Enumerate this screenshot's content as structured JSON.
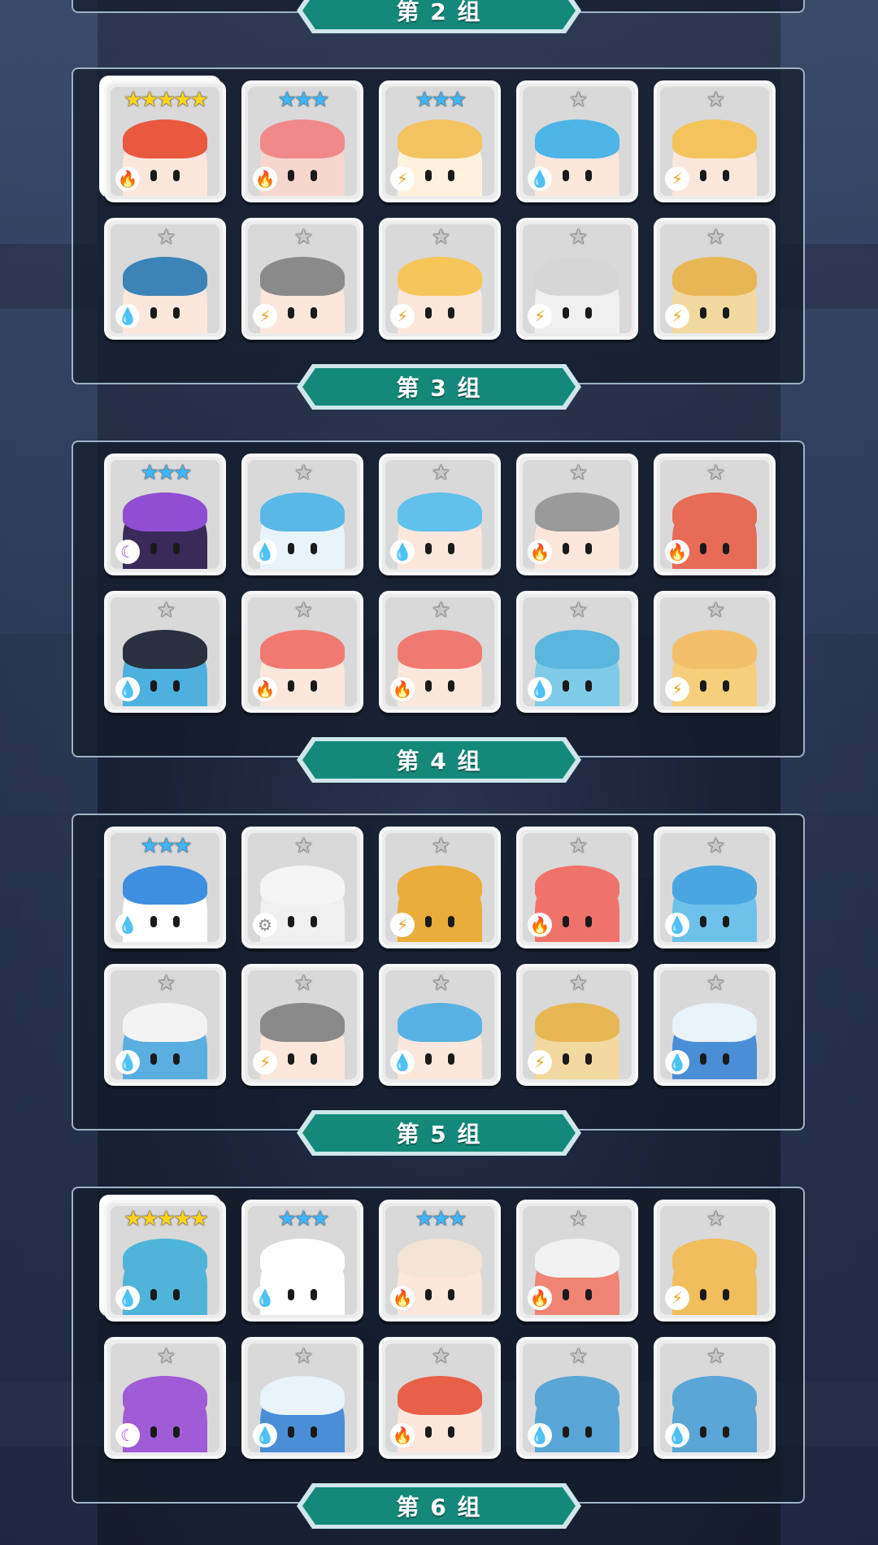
{
  "colors": {
    "banner": "#14897a",
    "banner_edge": "#cfe6ea",
    "fire": "#e0462a",
    "water": "#2f8fe0",
    "lightning": "#e8a322",
    "dark": "#a54ad8",
    "light": "#8c8c8c",
    "star_gold": "#ffd21e",
    "star_blue": "#3fb6ff",
    "star_white": "#c8c8c8"
  },
  "element_icons": {
    "fire": "🔥",
    "water": "💧",
    "lightning": "⚡",
    "dark": "☾",
    "light": "⚙"
  },
  "labels": [
    "第 2 组",
    "第 3 组",
    "第 4 组",
    "第 5 组",
    "第 6 组"
  ],
  "groups": [
    {
      "cards": [
        {
          "stars": "★★★★★",
          "star_color": "gold",
          "element": "fire",
          "highlight": true,
          "hair": "#e8593f",
          "skin": "#fbe7dc"
        },
        {
          "stars": "★★★",
          "star_color": "blue",
          "element": "fire",
          "hair": "#f08a8a",
          "skin": "#f6d7cf"
        },
        {
          "stars": "★★★",
          "star_color": "blue",
          "element": "lightning",
          "hair": "#f2c462",
          "skin": "#fff1dc"
        },
        {
          "stars": "★",
          "star_color": "white",
          "element": "water",
          "hair": "#4cb5e6",
          "skin": "#fbe7dc"
        },
        {
          "stars": "★",
          "star_color": "white",
          "element": "lightning",
          "hair": "#f3c45c",
          "skin": "#fbe7dc"
        },
        {
          "stars": "★",
          "star_color": "white",
          "element": "water",
          "hair": "#3c84b7",
          "skin": "#fbe7dc"
        },
        {
          "stars": "★",
          "star_color": "white",
          "element": "lightning",
          "hair": "#8a8a8a",
          "skin": "#fbe7dc"
        },
        {
          "stars": "★",
          "star_color": "white",
          "element": "lightning",
          "hair": "#f5c65a",
          "skin": "#fbe7dc"
        },
        {
          "stars": "★",
          "star_color": "white",
          "element": "lightning",
          "hair": "#d6d6d6",
          "skin": "#f0f0f0"
        },
        {
          "stars": "★",
          "star_color": "white",
          "element": "lightning",
          "hair": "#e8b755",
          "skin": "#f1d9a0"
        }
      ]
    },
    {
      "cards": [
        {
          "stars": "★★★",
          "star_color": "blue",
          "element": "dark",
          "hair": "#8f4ed3",
          "skin": "#3a2a5a"
        },
        {
          "stars": "★",
          "star_color": "white",
          "element": "water",
          "hair": "#5ab8e9",
          "skin": "#e8f4fa"
        },
        {
          "stars": "★",
          "star_color": "white",
          "element": "water",
          "hair": "#62c0ec",
          "skin": "#fbe7dc"
        },
        {
          "stars": "★",
          "star_color": "white",
          "element": "fire",
          "hair": "#9a9a9a",
          "skin": "#fbe7dc"
        },
        {
          "stars": "★",
          "star_color": "white",
          "element": "fire",
          "hair": "#e86b58",
          "skin": "#e86b58"
        },
        {
          "stars": "★",
          "star_color": "white",
          "element": "water",
          "hair": "#2a3040",
          "skin": "#4db0de"
        },
        {
          "stars": "★",
          "star_color": "white",
          "element": "fire",
          "hair": "#f07a72",
          "skin": "#fbe7dc"
        },
        {
          "stars": "★",
          "star_color": "white",
          "element": "fire",
          "hair": "#f07a72",
          "skin": "#fbe7dc"
        },
        {
          "stars": "★",
          "star_color": "white",
          "element": "water",
          "hair": "#5bb6dd",
          "skin": "#7fcbe8"
        },
        {
          "stars": "★",
          "star_color": "white",
          "element": "lightning",
          "hair": "#f2c06a",
          "skin": "#f6cf7c"
        }
      ]
    },
    {
      "cards": [
        {
          "stars": "★★★",
          "star_color": "blue",
          "element": "water",
          "hair": "#3e8fe0",
          "skin": "#ffffff"
        },
        {
          "stars": "★",
          "star_color": "white",
          "element": "light",
          "hair": "#f5f5f5",
          "skin": "#f0f0f0"
        },
        {
          "stars": "★",
          "star_color": "white",
          "element": "lightning",
          "hair": "#e9ad3c",
          "skin": "#e9ad3c"
        },
        {
          "stars": "★",
          "star_color": "white",
          "element": "fire",
          "hair": "#f0736b",
          "skin": "#f0736b"
        },
        {
          "stars": "★",
          "star_color": "white",
          "element": "water",
          "hair": "#4aa6e0",
          "skin": "#6ec2ea"
        },
        {
          "stars": "★",
          "star_color": "white",
          "element": "water",
          "hair": "#f3f3f3",
          "skin": "#5aaee0"
        },
        {
          "stars": "★",
          "star_color": "white",
          "element": "lightning",
          "hair": "#8a8a8a",
          "skin": "#fbe7dc"
        },
        {
          "stars": "★",
          "star_color": "white",
          "element": "water",
          "hair": "#58b3e4",
          "skin": "#fbe7dc"
        },
        {
          "stars": "★",
          "star_color": "white",
          "element": "lightning",
          "hair": "#e8b755",
          "skin": "#f1d9a0"
        },
        {
          "stars": "★",
          "star_color": "white",
          "element": "water",
          "hair": "#e9f3fa",
          "skin": "#4a8fd6"
        }
      ]
    },
    {
      "cards": [
        {
          "stars": "★★★★★",
          "star_color": "gold",
          "element": "water",
          "highlight": true,
          "hair": "#4fb4d8",
          "skin": "#4fb4d8"
        },
        {
          "stars": "★★★",
          "star_color": "blue",
          "element": "water",
          "hair": "#ffffff",
          "skin": "#ffffff"
        },
        {
          "stars": "★★★",
          "star_color": "blue",
          "element": "fire",
          "hair": "#f3e4d6",
          "skin": "#fbe7dc"
        },
        {
          "stars": "★",
          "star_color": "white",
          "element": "fire",
          "hair": "#f2f2f2",
          "skin": "#f08575"
        },
        {
          "stars": "★",
          "star_color": "white",
          "element": "lightning",
          "hair": "#f0be5c",
          "skin": "#f0be5c"
        },
        {
          "stars": "★",
          "star_color": "white",
          "element": "dark",
          "hair": "#a05bd6",
          "skin": "#a05bd6"
        },
        {
          "stars": "★",
          "star_color": "white",
          "element": "water",
          "hair": "#e9f3fa",
          "skin": "#4a8fd6"
        },
        {
          "stars": "★",
          "star_color": "white",
          "element": "fire",
          "hair": "#e9604a",
          "skin": "#fbe7dc"
        },
        {
          "stars": "★",
          "star_color": "white",
          "element": "water",
          "hair": "#5aa6d6",
          "skin": "#5aa6d6"
        },
        {
          "stars": "★",
          "star_color": "white",
          "element": "water",
          "hair": "#5aa6d6",
          "skin": "#5aa6d6"
        }
      ]
    }
  ]
}
